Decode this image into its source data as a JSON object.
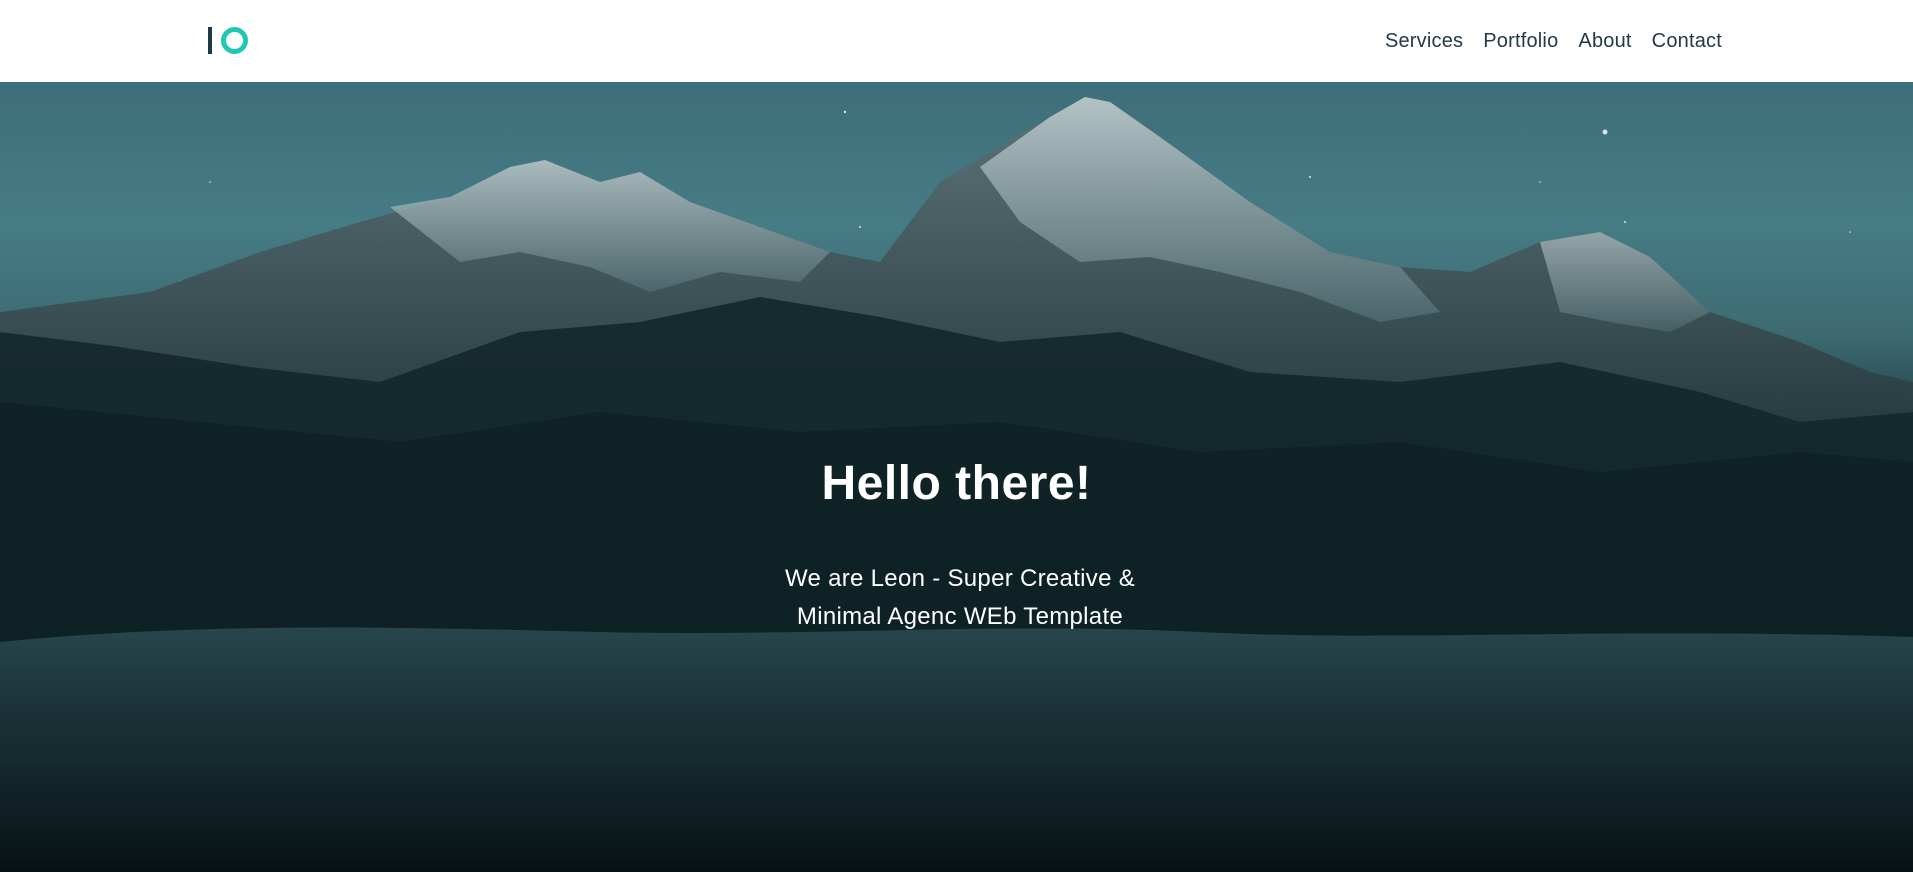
{
  "header": {
    "logo": {
      "icon": "io-logo-icon"
    },
    "nav": [
      {
        "label": "Services"
      },
      {
        "label": "Portfolio"
      },
      {
        "label": "About"
      },
      {
        "label": "Contact"
      }
    ]
  },
  "hero": {
    "title": "Hello there!",
    "subtitle_line1": "We are Leon - Super Creative &",
    "subtitle_line2": "Minimal Agenc WEb Template"
  },
  "colors": {
    "accent": "#1fc7b4",
    "nav_text": "#233a46",
    "logo_bar": "#1d3b46"
  }
}
